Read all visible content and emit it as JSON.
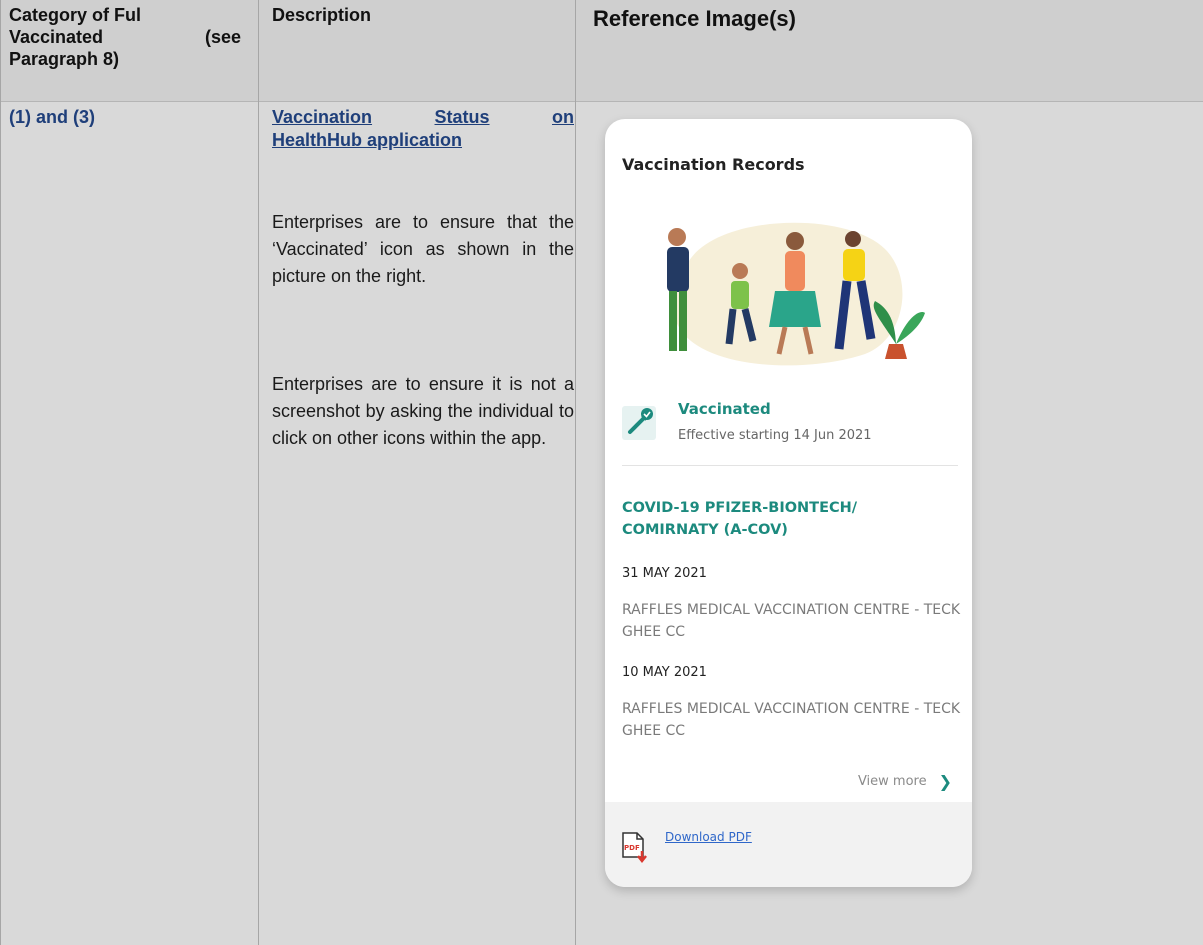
{
  "table": {
    "headers": {
      "category_line1": "Category of Ful",
      "category_line2_a": "Vaccinated",
      "category_line2_b": "(see",
      "category_line3": "Paragraph 8)",
      "description": "Description",
      "reference": "Reference Image(s)"
    },
    "row": {
      "category": "(1) and (3)",
      "title_line1_a": "Vaccination",
      "title_line1_b": "Status",
      "title_line1_c": "on",
      "title_line2": "HealthHub application",
      "paragraph1": "Enterprises are to ensure that the ‘Vaccinated’ icon as shown in the picture on the right.",
      "paragraph2": "Enterprises are to ensure it is not a screenshot by asking the individual to click on other icons within the app."
    }
  },
  "app": {
    "title": "Vaccination Records",
    "status": {
      "label": "Vaccinated",
      "effective": "Effective starting 14 Jun 2021"
    },
    "vaccine_name": "COVID-19 PFIZER-BIONTECH/ COMIRNATY (A-COV)",
    "doses": [
      {
        "date": "31 MAY 2021",
        "place": "RAFFLES MEDICAL VACCINATION CENTRE - TECK GHEE CC"
      },
      {
        "date": "10 MAY 2021",
        "place": "RAFFLES MEDICAL VACCINATION CENTRE - TECK GHEE CC"
      }
    ],
    "view_more": "View more",
    "download": "Download PDF",
    "pdf_icon_text": "PDF"
  },
  "colors": {
    "header_bg": "#cfcfcf",
    "row_bg": "#d9d9d9",
    "link_blue": "#1f3f7a",
    "accent_teal": "#1c8a7e",
    "download_blue": "#2f67c9"
  },
  "icons": [
    "vaccine-check-icon",
    "chevron-right-icon",
    "pdf-download-icon"
  ]
}
